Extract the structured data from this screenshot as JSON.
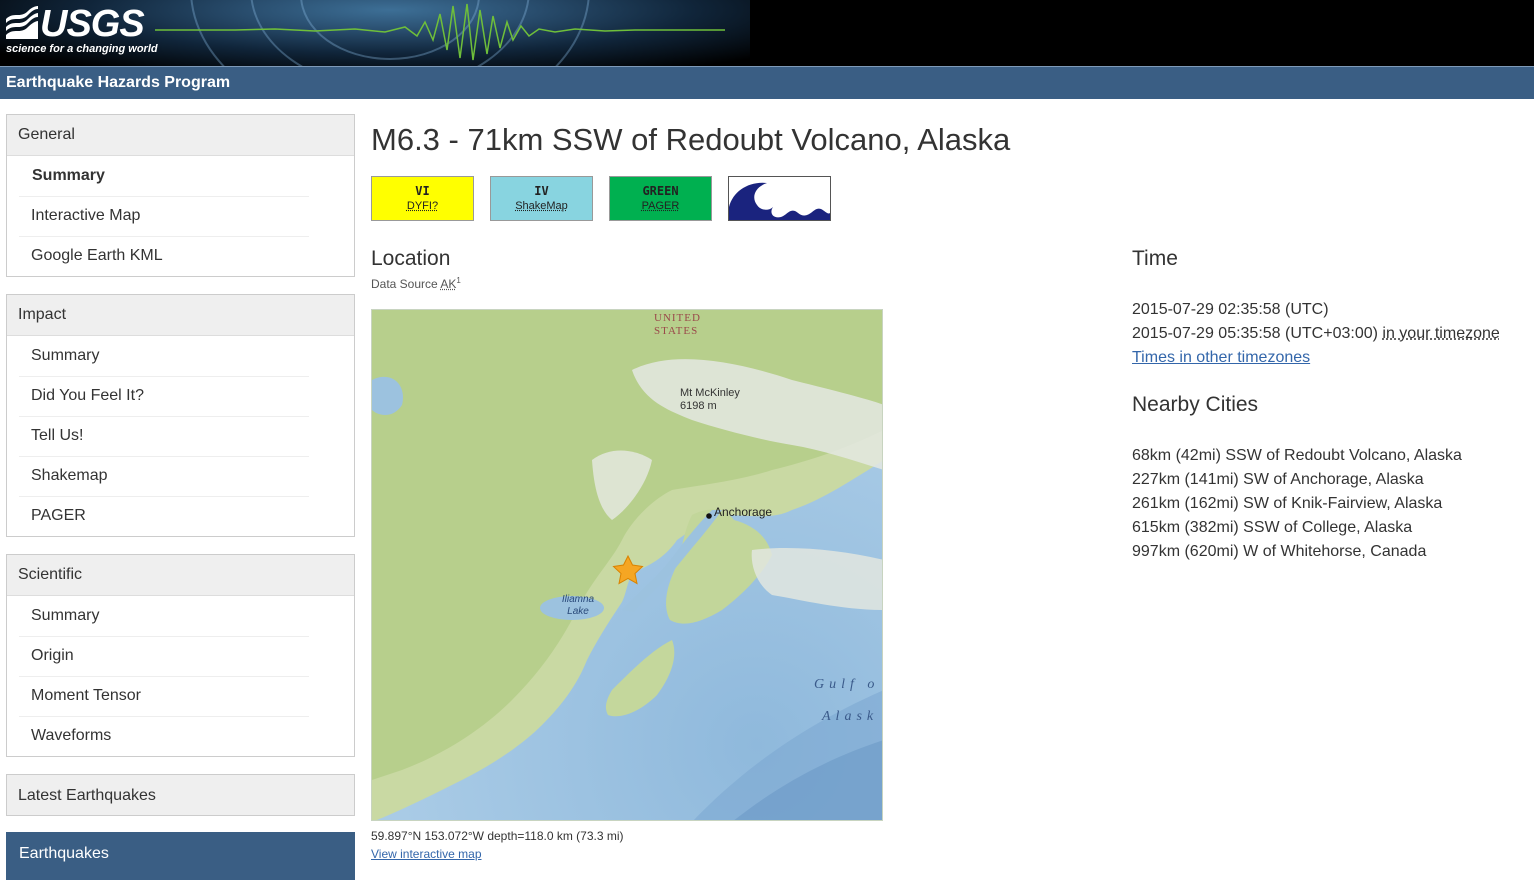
{
  "header": {
    "logo_text": "USGS",
    "logo_tagline": "science for a changing world",
    "program": "Earthquake Hazards Program"
  },
  "sidebar": {
    "general": {
      "heading": "General",
      "items": [
        "Summary",
        "Interactive Map",
        "Google Earth KML"
      ],
      "active": "Summary"
    },
    "impact": {
      "heading": "Impact",
      "items": [
        "Summary",
        "Did You Feel It?",
        "Tell Us!",
        "Shakemap",
        "PAGER"
      ]
    },
    "scientific": {
      "heading": "Scientific",
      "items": [
        "Summary",
        "Origin",
        "Moment Tensor",
        "Waveforms"
      ]
    },
    "latest": "Latest Earthquakes",
    "earthquakes": "Earthquakes"
  },
  "event": {
    "title": "M6.3 - 71km SSW of Redoubt Volcano, Alaska"
  },
  "badges": {
    "dyfi": {
      "level": "VI",
      "label": "DYFI?",
      "color": "#ffff00"
    },
    "shakemap": {
      "level": "IV",
      "label": "ShakeMap",
      "color": "#88d4e0"
    },
    "pager": {
      "level": "GREEN",
      "label": "PAGER",
      "color": "#00b050"
    },
    "tsunami": {
      "icon": "tsunami-icon"
    }
  },
  "location": {
    "heading": "Location",
    "data_source_label": "Data Source",
    "data_source": "AK",
    "data_source_sup": "1",
    "map_labels": {
      "country": "UNITED STATES",
      "peak": "Mt McKinley",
      "peak_elev": "6198 m",
      "city": "Anchorage",
      "lake": "Iliamna Lake",
      "gulf": "Gulf o",
      "alaska": "Alask"
    },
    "coords": "59.897°N 153.072°W depth=118.0 km (73.3 mi)",
    "map_link": "View interactive map"
  },
  "time": {
    "heading": "Time",
    "utc": "2015-07-29 02:35:58 (UTC)",
    "local": "2015-07-29 05:35:58 (UTC+03:00)",
    "local_suffix": "in your timezone",
    "other_link": "Times in other timezones"
  },
  "nearby": {
    "heading": "Nearby Cities",
    "cities": [
      "68km (42mi) SSW of Redoubt Volcano, Alaska",
      "227km (141mi) SW of Anchorage, Alaska",
      "261km (162mi) SW of Knik-Fairview, Alaska",
      "615km (382mi) SSW of College, Alaska",
      "997km (620mi) W of Whitehorse, Canada"
    ]
  }
}
